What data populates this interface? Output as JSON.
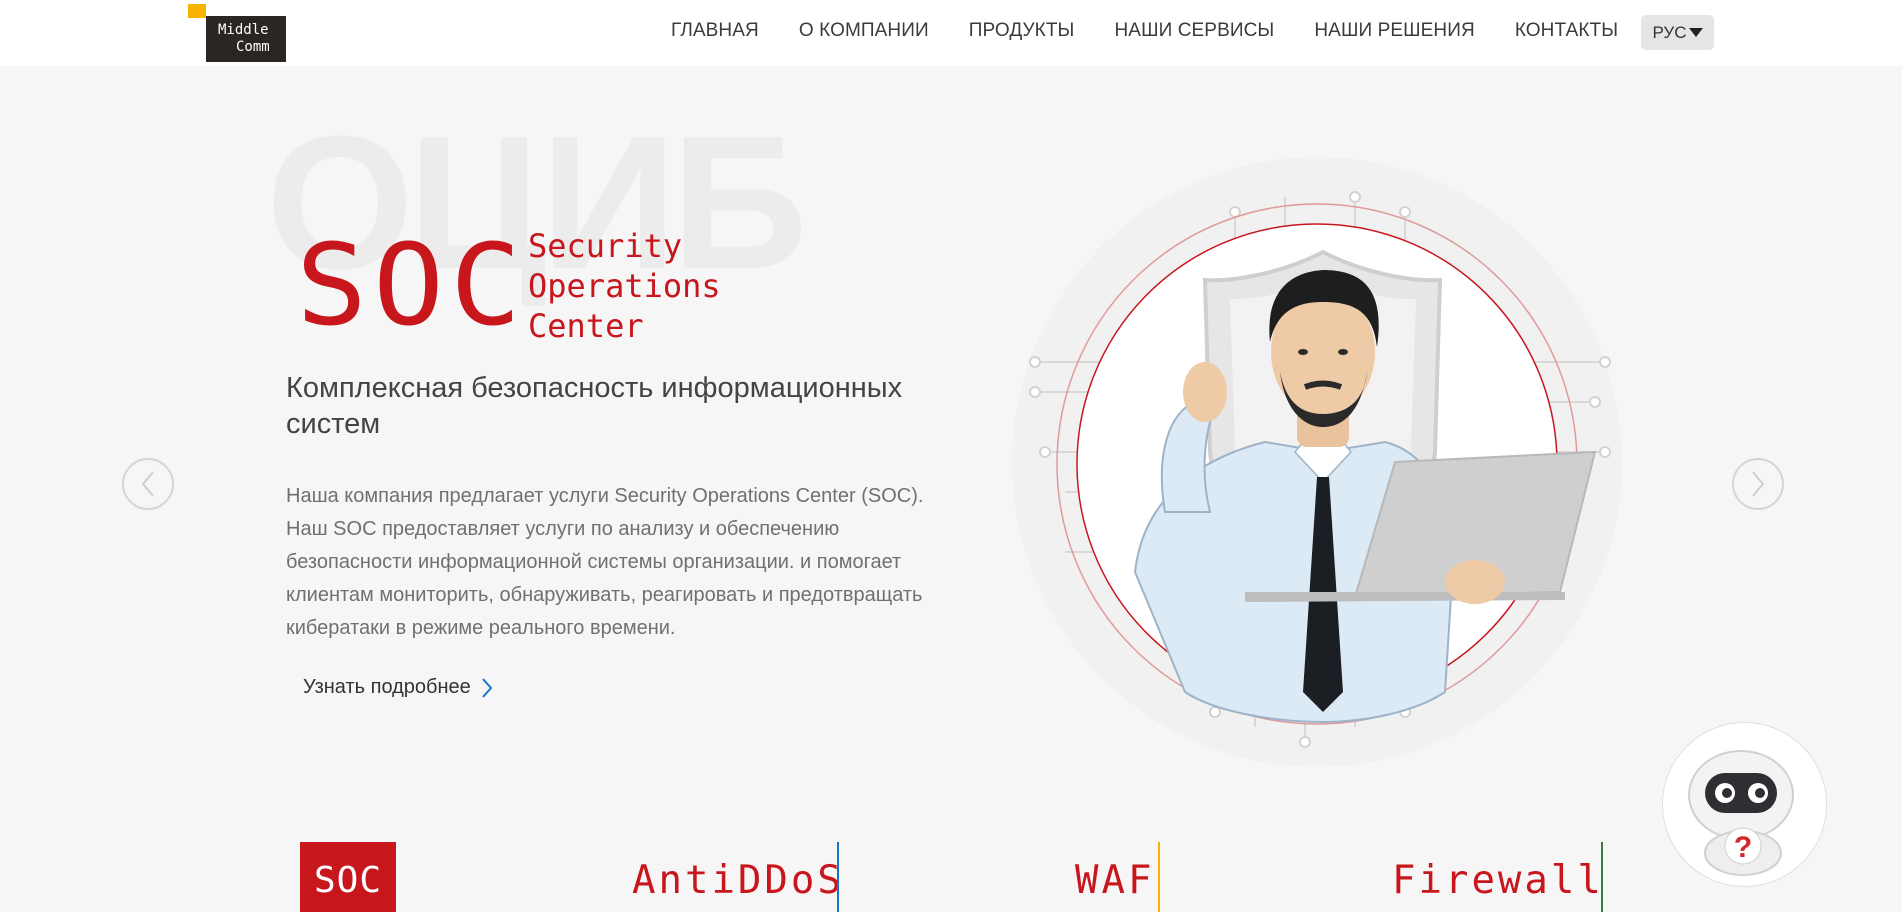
{
  "logo": {
    "line1": "Middle",
    "line2": "Comm"
  },
  "nav": {
    "items": [
      "ГЛАВНАЯ",
      "О КОМПАНИИ",
      "ПРОДУКТЫ",
      "НАШИ СЕРВИСЫ",
      "НАШИ РЕШЕНИЯ",
      "КОНТАКТЫ"
    ],
    "lang": "РУС"
  },
  "hero": {
    "bg_word": "ОЦИБ",
    "soc_title": "SOC",
    "soc_subtitle": [
      "Security",
      "Operations",
      "Center"
    ],
    "headline": "Комплексная безопасность информационных систем",
    "description": "Наша компания предлагает услуги Security Operations Center (SOC). Наш SOC предоставляет услуги по анализу и обеспечению безопасности информационной системы организации. и помогает клиентам мониторить, обнаруживать, реагировать и предотвращать кибератаки в режиме реального времени.",
    "more_label": "Узнать подробнее"
  },
  "products": [
    "SOC",
    "AntiDDoS",
    "WAF",
    "Firewall"
  ],
  "colors": {
    "brand_red": "#c8161d",
    "logo_yellow": "#f6b400",
    "logo_dark": "#2b2622",
    "link_blue": "#1a73c8"
  }
}
